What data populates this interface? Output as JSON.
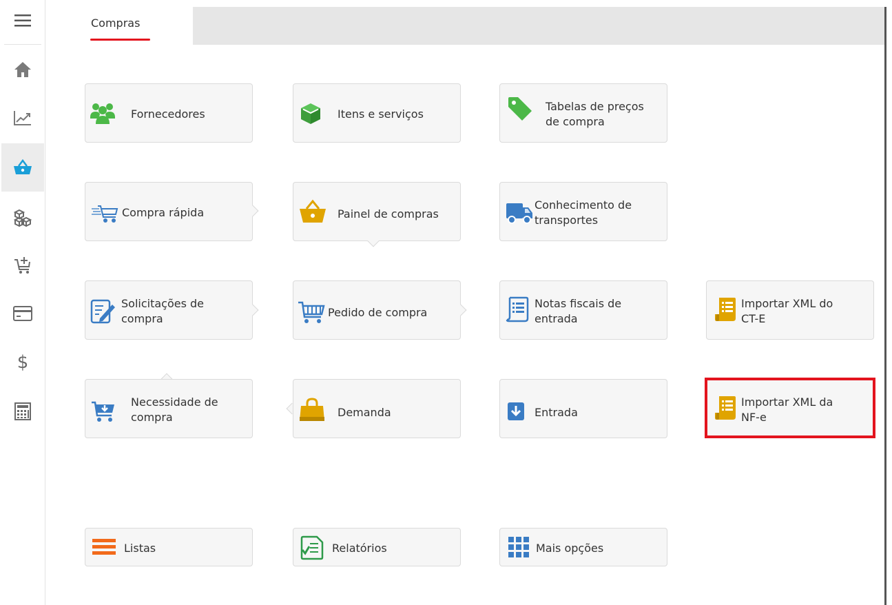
{
  "colors": {
    "accent": "#1a9fd8",
    "highlight": "#e3141e",
    "green": "#4cb848",
    "gold": "#e0a400",
    "blue": "#3a7cc4"
  },
  "sidebar": {
    "items": [
      {
        "icon": "menu-icon"
      },
      {
        "icon": "home-icon"
      },
      {
        "icon": "chart-icon"
      },
      {
        "icon": "basket-icon",
        "active": true
      },
      {
        "icon": "boxes-icon"
      },
      {
        "icon": "cart-add-icon"
      },
      {
        "icon": "card-icon"
      },
      {
        "icon": "dollar-icon"
      },
      {
        "icon": "calculator-icon"
      }
    ]
  },
  "tabs": [
    {
      "label": "Compras",
      "active": true
    }
  ],
  "cards": {
    "fornecedores": {
      "line1": "Fornecedores",
      "line2": "",
      "icon": "users-icon"
    },
    "itens": {
      "line1": "Itens e serviços",
      "line2": "",
      "icon": "cube-icon"
    },
    "tabelas": {
      "line1": "Tabelas de preços",
      "line2": "de compra",
      "icon": "tag-icon"
    },
    "compra_rapida": {
      "line1": "Compra rápida",
      "line2": "",
      "icon": "fast-cart-icon"
    },
    "painel": {
      "line1": "Painel de compras",
      "line2": "",
      "icon": "basket-icon"
    },
    "conhecimento": {
      "line1": "Conhecimento de",
      "line2": "transportes",
      "icon": "truck-icon"
    },
    "solicitacoes": {
      "line1": "Solicitações de",
      "line2": "compra",
      "icon": "edit-document-icon"
    },
    "pedido": {
      "line1": "Pedido de compra",
      "line2": "",
      "icon": "cart-icon"
    },
    "notas": {
      "line1": "Notas fiscais de",
      "line2": "entrada",
      "icon": "document-list-icon"
    },
    "importar_cte": {
      "line1": "Importar XML do",
      "line2": "CT-E",
      "icon": "receipt-icon"
    },
    "necessidade": {
      "line1": "Necessidade de",
      "line2": "compra",
      "icon": "cart-down-icon"
    },
    "demanda": {
      "line1": "Demanda",
      "line2": "",
      "icon": "shopping-bag-icon"
    },
    "entrada": {
      "line1": "Entrada",
      "line2": "",
      "icon": "download-box-icon"
    },
    "importar_nfe": {
      "line1": "Importar XML da",
      "line2": "NF-e",
      "icon": "receipt-icon"
    },
    "listas": {
      "line1": "Listas",
      "icon": "list-icon"
    },
    "relatorios": {
      "line1": "Relatórios",
      "icon": "report-icon"
    },
    "mais": {
      "line1": "Mais opções",
      "icon": "grid-icon"
    }
  }
}
